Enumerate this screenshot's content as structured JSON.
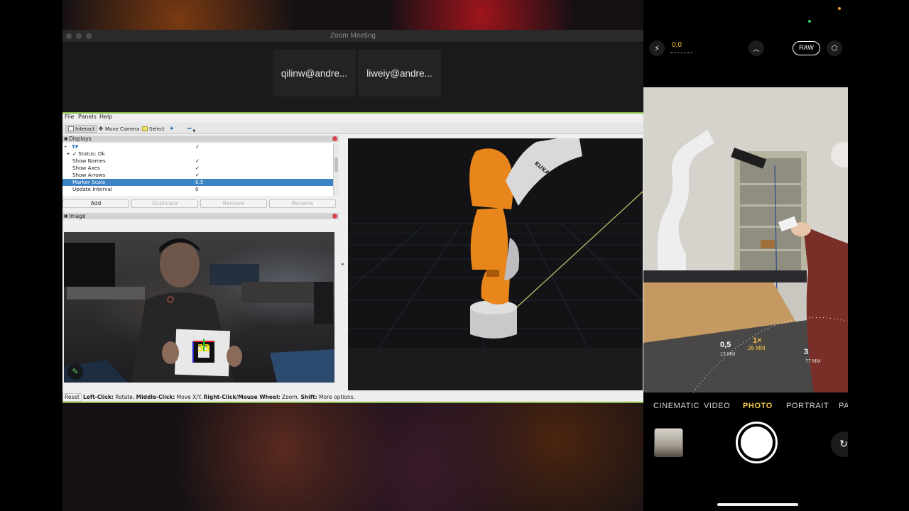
{
  "zoom": {
    "title": "Zoom Meeting",
    "participants": [
      "qilinw@andre...",
      "liweiy@andre..."
    ]
  },
  "rviz": {
    "menu": [
      "File",
      "Panels",
      "Help"
    ],
    "toolbar": {
      "interact": "Interact",
      "move_camera": "Move Camera",
      "select": "Select"
    },
    "displays_panel": {
      "title": "Displays",
      "rows": [
        {
          "label": "TF",
          "value": "✓"
        },
        {
          "label": "✓  Status: Ok",
          "value": ""
        },
        {
          "label": "Show Names",
          "value": "✓"
        },
        {
          "label": "Show Axes",
          "value": "✓"
        },
        {
          "label": "Show Arrows",
          "value": "✓"
        },
        {
          "label": "Marker Scale",
          "value": "0.5"
        },
        {
          "label": "Update Interval",
          "value": "0"
        }
      ],
      "selected_row": "Marker Scale",
      "buttons": {
        "add": "Add",
        "duplicate": "Duplicate",
        "remove": "Remove",
        "rename": "Rename"
      }
    },
    "image_panel": {
      "title": "Image",
      "marker_id": "33"
    },
    "view3d": {
      "robot_label": "KUKA"
    },
    "status": {
      "reset": "Reset",
      "left_click_key": "Left-Click:",
      "left_click_text": " Rotate. ",
      "middle_click_key": "Middle-Click:",
      "middle_click_text": " Move X/Y. ",
      "right_click_key": "Right-Click/Mouse Wheel:",
      "right_click_text": " Zoom. ",
      "shift_key": "Shift:",
      "shift_text": " More options."
    },
    "colors": {
      "accent_border": "#86b841",
      "selection": "#3d84c4",
      "robot_orange": "#e8861c"
    }
  },
  "camera": {
    "exposure_value": "0,0",
    "raw_label": "RAW",
    "zoom_levels": [
      "0,5",
      "1×",
      "3"
    ],
    "focal_length": "26 MM",
    "focal_small_left": "13 MM",
    "focal_small_right": "77 MM",
    "modes": [
      "CINEMATIC",
      "VIDEO",
      "PHOTO",
      "PORTRAIT",
      "PA"
    ],
    "active_mode": "PHOTO",
    "colors": {
      "active_mode": "#f6c746"
    }
  }
}
